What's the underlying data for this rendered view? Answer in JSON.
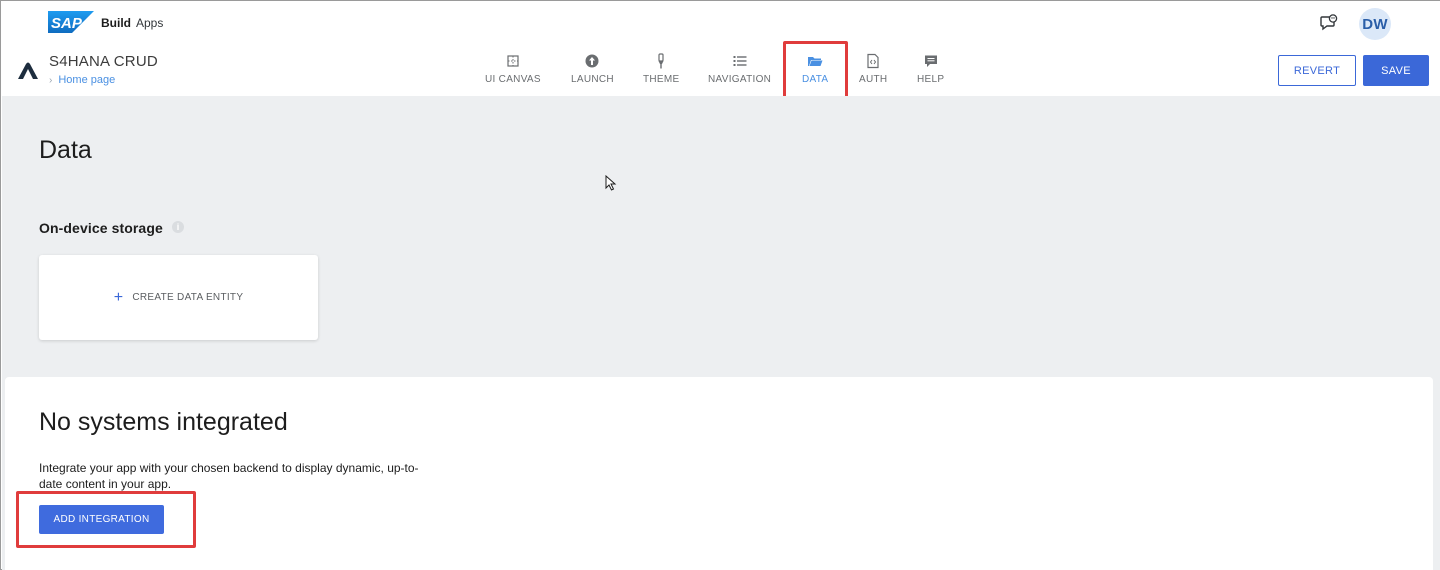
{
  "shell": {
    "logo_text": "SAP",
    "product": "Build",
    "product_sub": "Apps",
    "avatar_initials": "DW"
  },
  "app": {
    "title": "S4HANA CRUD",
    "breadcrumb": "Home page"
  },
  "nav": {
    "tabs": [
      {
        "label": "UI CANVAS",
        "icon": "canvas-icon"
      },
      {
        "label": "LAUNCH",
        "icon": "launch-icon"
      },
      {
        "label": "THEME",
        "icon": "theme-icon"
      },
      {
        "label": "NAVIGATION",
        "icon": "navigation-icon"
      },
      {
        "label": "DATA",
        "icon": "folder-icon",
        "active": true
      },
      {
        "label": "AUTH",
        "icon": "auth-file-icon"
      },
      {
        "label": "HELP",
        "icon": "help-chat-icon"
      }
    ]
  },
  "actions": {
    "revert_label": "REVERT",
    "save_label": "SAVE"
  },
  "data_page": {
    "title": "Data",
    "storage_label": "On-device storage",
    "info_glyph": "i",
    "create_entity_label": "CREATE DATA ENTITY"
  },
  "integration": {
    "title": "No systems integrated",
    "description": "Integrate your app with your chosen backend to display dynamic, up-to-date content in your app.",
    "button_label": "ADD INTEGRATION"
  },
  "colors": {
    "accent": "#3b68d8",
    "active_tab": "#4a90e2",
    "highlight": "#e03c3c",
    "content_bg": "#edeff1"
  }
}
